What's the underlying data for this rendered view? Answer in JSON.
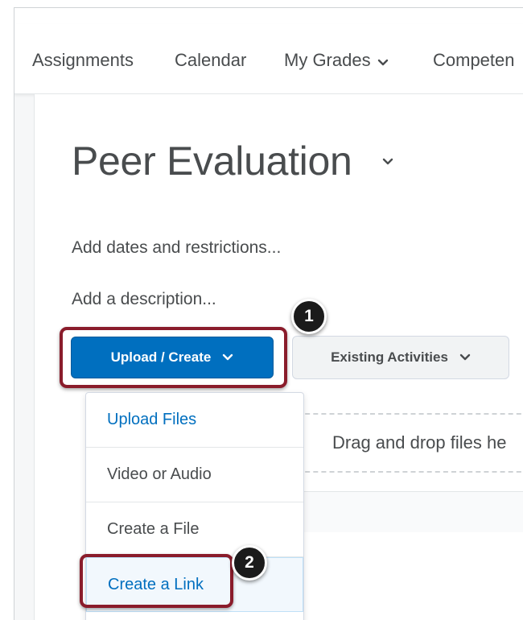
{
  "nav": {
    "items": [
      {
        "label": "Assignments"
      },
      {
        "label": "Calendar"
      },
      {
        "label": "My Grades"
      },
      {
        "label": "Competen"
      }
    ]
  },
  "page": {
    "title": "Peer Evaluation",
    "add_dates": "Add dates and restrictions...",
    "add_description": "Add a description..."
  },
  "toolbar": {
    "upload_create_label": "Upload / Create",
    "existing_activities_label": "Existing Activities"
  },
  "dropdown": {
    "items": [
      {
        "label": "Upload Files"
      },
      {
        "label": "Video or Audio"
      },
      {
        "label": "Create a File"
      },
      {
        "label": "Create a Link"
      }
    ]
  },
  "dropzone": {
    "text": "Drag and drop files he"
  },
  "annotations": {
    "step1": "1",
    "step2": "2"
  },
  "colors": {
    "primary": "#006fbf",
    "highlight": "#8a1c2b",
    "text": "#494c4e"
  }
}
